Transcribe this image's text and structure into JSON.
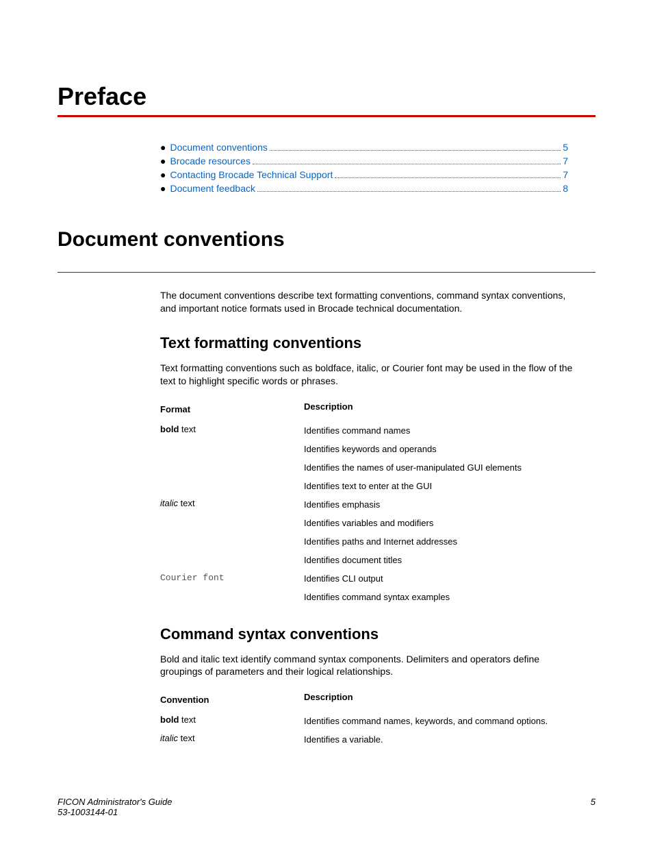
{
  "chapter_title": "Preface",
  "toc": [
    {
      "label": "Document conventions",
      "page": "5"
    },
    {
      "label": "Brocade resources",
      "page": "7"
    },
    {
      "label": "Contacting Brocade Technical Support",
      "page": "7"
    },
    {
      "label": "Document feedback",
      "page": "8"
    }
  ],
  "section1": {
    "title": "Document conventions",
    "intro": "The document conventions describe text formatting conventions, command syntax conventions, and important notice formats used in Brocade technical documentation."
  },
  "text_formatting": {
    "title": "Text formatting conventions",
    "intro": "Text formatting conventions such as boldface, italic, or Courier font may be used in the flow of the text to highlight specific words or phrases.",
    "header_format": "Format",
    "header_desc": "Description",
    "rows": [
      {
        "format_prefix": "bold",
        "format_suffix": " text",
        "format_class": "bold",
        "desc": [
          "Identifies command names",
          "Identifies keywords and operands",
          "Identifies the names of user-manipulated GUI elements",
          "Identifies text to enter at the GUI"
        ]
      },
      {
        "format_prefix": "italic",
        "format_suffix": " text",
        "format_class": "italic",
        "desc": [
          "Identifies emphasis",
          "Identifies variables and modifiers",
          "Identifies paths and Internet addresses",
          "Identifies document titles"
        ]
      },
      {
        "format_prefix": "Courier font",
        "format_suffix": "",
        "format_class": "courier",
        "desc": [
          "Identifies CLI output",
          "Identifies command syntax examples"
        ]
      }
    ]
  },
  "command_syntax": {
    "title": "Command syntax conventions",
    "intro": "Bold and italic text identify command syntax components. Delimiters and operators define groupings of parameters and their logical relationships.",
    "header_conv": "Convention",
    "header_desc": "Description",
    "rows": [
      {
        "format_prefix": "bold",
        "format_suffix": " text",
        "format_class": "bold",
        "desc": "Identifies command names, keywords, and command options."
      },
      {
        "format_prefix": "italic",
        "format_suffix": " text",
        "format_class": "italic",
        "desc": "Identifies a variable."
      }
    ]
  },
  "footer": {
    "doc_title": "FICON Administrator's Guide",
    "doc_number": "53-1003144-01",
    "page": "5"
  }
}
